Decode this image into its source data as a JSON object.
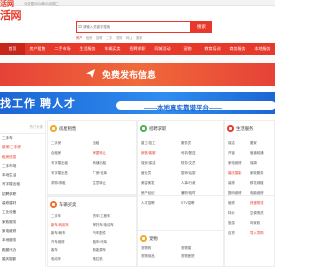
{
  "topbar": {
    "logo_tail": "活网",
    "welcome": "今天是2024年01月周二"
  },
  "logo": {
    "text": "活网"
  },
  "search": {
    "placeholder": "请输入关键字搜索",
    "button": "搜索",
    "hot": [
      "房产",
      "租房",
      "招聘",
      "二手",
      "宠物",
      "转让",
      "搬家"
    ]
  },
  "nav": {
    "items": [
      "首页",
      "房产租售",
      "二手市场",
      "生活服务",
      "车辆买卖",
      "招聘求职",
      "同城活动",
      "宠物",
      "教育培训",
      "商务服务",
      "本地服务"
    ]
  },
  "banner1": {
    "text": "免费发布信息"
  },
  "banner2": {
    "big": "找工作 聘人才",
    "pill": "——本地真实靠谱平台——"
  },
  "left_col": {
    "head": "热门分类",
    "rows": [
      "二手车",
      "新房/二手房",
      "租房信息",
      "二手市场",
      "本地生活",
      "写字楼出租",
      "招聘求职",
      "装修建材",
      "工业设备",
      "家政服务",
      "家电维修",
      "本地服务",
      "跑腿代办",
      "婚庆摄影"
    ]
  },
  "cards": {
    "house": {
      "title": "房屋租售",
      "items": [
        "二手房",
        "出租",
        "合租房",
        "房屋转让",
        "写字楼出租",
        "商铺出租",
        "写字楼出售",
        "厂房/仓库",
        "求购/求租",
        "生意转让"
      ]
    },
    "jobs": {
      "title": "招聘求职",
      "items": [
        "普工/技工",
        "服务员",
        "销售/客服",
        "司机/配送",
        "保安/保洁",
        "财务/文员",
        "营业员",
        "厨师/后厨",
        "美容美发",
        "人事/行政",
        "房产经纪",
        "兼职/临时",
        "人才招聘",
        "STV招聘"
      ]
    },
    "life": {
      "title": "生活服务",
      "items": [
        "保洁",
        "搬家",
        "开锁",
        "管道疏通",
        "家电维修",
        "保姆",
        "婚庆摄影",
        "家政服务",
        "装修",
        "鲜花绿植",
        "数码维修",
        "电脑维修",
        "维修",
        "快递物流",
        "特价",
        "空调清洗",
        "旅游",
        "叫家政",
        "百货",
        "导入导购"
      ]
    },
    "cars": {
      "title": "车辆买卖",
      "items": [
        "二手车",
        "货车/工程车",
        "新车/商用车",
        "摩托车/电动车",
        "新车/轿车",
        "汽车配件",
        "汽车维修",
        "租车/代驾",
        "客车",
        "新能源车",
        "电动车",
        "拖拉机",
        "二手摩托",
        "车辆过户",
        "驾校/陪练",
        "代办"
      ]
    },
    "pets": {
      "title": "宠物",
      "items": [
        "宠物狗",
        "宠物猫",
        "宠物用品",
        "宠物医院",
        "宠物美容",
        "猫粮/狗粮",
        "异宠",
        "宠物寄养",
        "宠物配种",
        "领养/赠送",
        "水族",
        "花鸟鱼虫"
      ]
    }
  }
}
